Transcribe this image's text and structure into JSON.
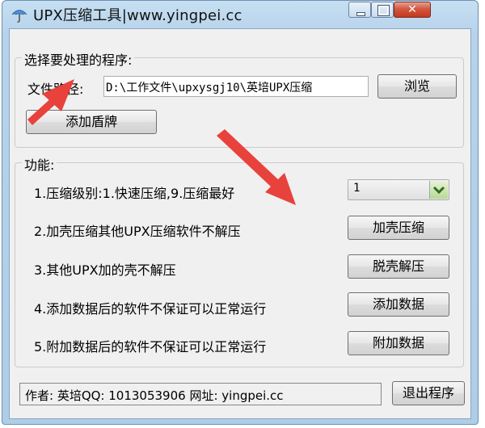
{
  "window": {
    "title": "UPX压缩工具|www.yingpei.cc",
    "controls": {
      "close_glyph": "✕"
    }
  },
  "program_group": {
    "label": "选择要处理的程序:",
    "file_path_label": "文件路径:",
    "file_path_value": "D:\\工作文件\\upxysgj10\\英培UPX压缩",
    "browse_label": "浏览",
    "add_shield_label": "添加盾牌"
  },
  "functions_group": {
    "label": "功能:",
    "compress_level_text": "1.压缩级别:1.快速压缩,9.压缩最好",
    "compress_level_selected": "1",
    "pack_text": "2.加壳压缩其他UPX压缩软件不解压",
    "pack_button": "加壳压缩",
    "unpack_text": "3.其他UPX加的壳不解压",
    "unpack_button": "脱壳解压",
    "add_data_text": "4.添加数据后的软件不保证可以正常运行",
    "add_data_button": "添加数据",
    "attach_data_text": "5.附加数据后的软件不保证可以正常运行",
    "attach_data_button": "附加数据"
  },
  "footer": {
    "author_info": "作者: 英培QQ: 1013053906 网址: yingpei.cc",
    "exit_label": "退出程序"
  },
  "colors": {
    "annotation_arrow": "#e8423c",
    "title_bar": "#b7d3eb",
    "close_button": "#c2381f"
  },
  "icons": {
    "app": "umbrella-icon",
    "dropdown": "chevron-down-icon"
  }
}
